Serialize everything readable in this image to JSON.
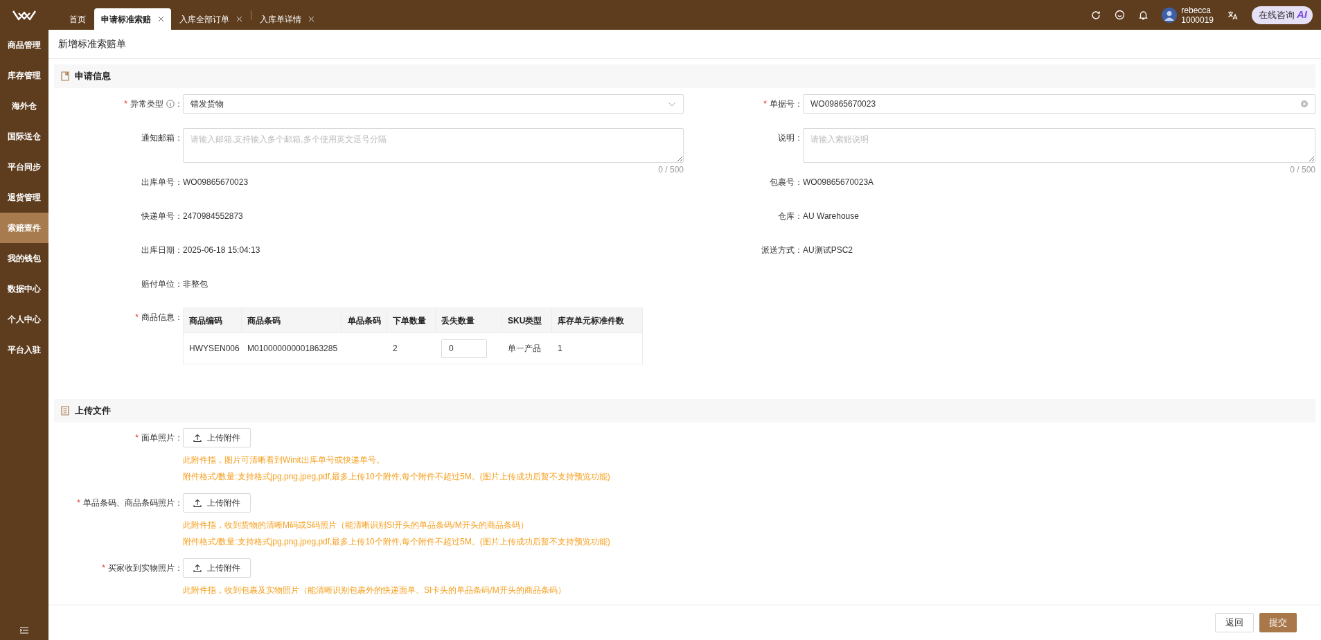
{
  "topbar": {
    "tabs": [
      {
        "label": "首页",
        "selected": false,
        "closable": false
      },
      {
        "label": "申请标准索赔",
        "selected": true,
        "closable": true
      },
      {
        "label": "入库全部订单",
        "selected": false,
        "closable": true
      },
      {
        "label": "入库单详情",
        "selected": false,
        "closable": true
      }
    ],
    "user": {
      "name": "rebecca",
      "id": "1000019"
    },
    "consult_button": {
      "label": "在线咨询",
      "badge": "AI"
    }
  },
  "sidebar": {
    "items": [
      {
        "label": "商品管理",
        "selected": false
      },
      {
        "label": "库存管理",
        "selected": false
      },
      {
        "label": "海外仓",
        "selected": false
      },
      {
        "label": "国际送仓",
        "selected": false
      },
      {
        "label": "平台同步",
        "selected": false
      },
      {
        "label": "退货管理",
        "selected": false
      },
      {
        "label": "索赔查件",
        "selected": true
      },
      {
        "label": "我的钱包",
        "selected": false
      },
      {
        "label": "数据中心",
        "selected": false
      },
      {
        "label": "个人中心",
        "selected": false
      },
      {
        "label": "平台入驻",
        "selected": false
      }
    ]
  },
  "page_title": "新增标准索赔单",
  "application_section": {
    "title": "申请信息",
    "rows": [
      {
        "left": {
          "kind": "select",
          "mark": "*",
          "label": "异常类型",
          "info": true,
          "colon": "：",
          "value": "错发货物"
        },
        "right": {
          "kind": "input",
          "mark": "*",
          "label": "单据号：",
          "value": "WO09865670023",
          "clearable": true
        }
      },
      {
        "left": {
          "kind": "textarea",
          "label": "通知邮箱：",
          "placeholder": "请输入邮箱,支持输入多个邮箱,多个使用英文逗号分隔",
          "counter": "0 / 500"
        },
        "right": {
          "kind": "textarea",
          "label": "说明：",
          "placeholder": "请输入索赔说明",
          "counter": "0 / 500"
        }
      },
      {
        "left": {
          "kind": "text",
          "label": "出库单号：",
          "value": "WO09865670023"
        },
        "right": {
          "kind": "text",
          "label": "包裹号：",
          "value": "WO09865670023A"
        }
      },
      {
        "left": {
          "kind": "text",
          "label": "快递单号：",
          "value": "2470984552873"
        },
        "right": {
          "kind": "text",
          "label": "仓库：",
          "value": "AU Warehouse"
        }
      },
      {
        "left": {
          "kind": "text",
          "label": "出库日期：",
          "value": "2025-06-18 15:04:13"
        },
        "right": {
          "kind": "text",
          "label": "派送方式：",
          "value": "AU测试PSC2"
        }
      },
      {
        "left": {
          "kind": "text",
          "label": "赔付单位：",
          "value": "非整包"
        }
      },
      {
        "left": {
          "kind": "table",
          "mark": "*",
          "label": "商品信息：",
          "columns": [
            "商品编码",
            "商品条码",
            "单品条码",
            "下单数量",
            "丢失数量",
            "SKU类型",
            "库存单元标准件数"
          ],
          "rows": [
            {
              "cells": [
                {
                  "kind": "text",
                  "text": "HWYSEN006"
                },
                {
                  "kind": "text",
                  "text": "M010000000001863285"
                },
                {
                  "kind": "empty"
                },
                {
                  "kind": "text",
                  "text": "2"
                },
                {
                  "kind": "input",
                  "value": "0"
                },
                {
                  "kind": "text",
                  "text": "单一产品"
                },
                {
                  "kind": "text",
                  "text": "1"
                }
              ]
            }
          ]
        }
      }
    ]
  },
  "upload_section": {
    "title": "上传文件",
    "items": [
      {
        "mark": "*",
        "label": "面单照片：",
        "button": "上传附件",
        "hints": [
          "此附件指，图片可清晰看到Winit出库单号或快递单号。",
          "附件格式/数量:支持格式jpg,png,jpeg,pdf,最多上传10个附件,每个附件不超过5M。(图片上传成功后暂不支持预览功能)"
        ]
      },
      {
        "mark": "*",
        "label": "单品条码、商品条码照片：",
        "button": "上传附件",
        "hints": [
          "此附件指，收到货物的清晰M码或S码照片（能清晰识别SI开头的单品条码/M开头的商品条码）",
          "附件格式/数量:支持格式jpg,png,jpeg,pdf,最多上传10个附件,每个附件不超过5M。(图片上传成功后暂不支持预览功能)"
        ]
      },
      {
        "mark": "*",
        "label": "买家收到实物照片：",
        "button": "上传附件",
        "hints": [
          "此附件指，收到包裹及实物照片（能清晰识别包裹外的快递面单、SI卡头的单品条码/M开头的商品条码）"
        ]
      }
    ]
  },
  "footer_buttons": [
    {
      "label": "返回",
      "kind": "default"
    },
    {
      "label": "提交",
      "kind": "primary"
    }
  ]
}
